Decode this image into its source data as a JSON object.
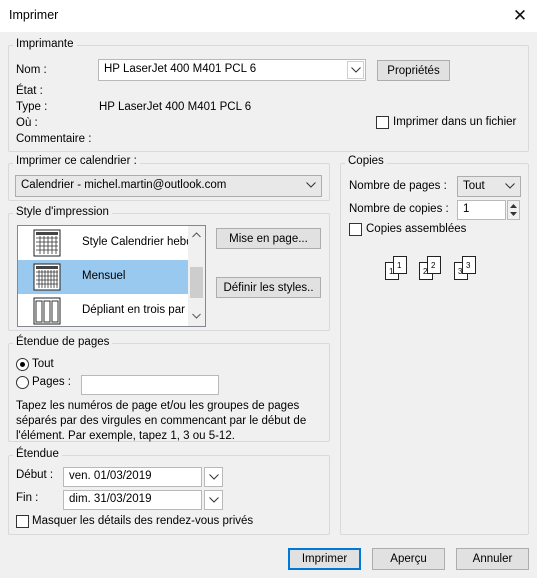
{
  "window": {
    "title": "Imprimer",
    "close_glyph": "✕"
  },
  "printer": {
    "legend": "Imprimante",
    "name_label": "Nom :",
    "name_value": "HP LaserJet 400 M401 PCL 6",
    "properties_button": "Propriétés",
    "status_label": "État :",
    "type_label": "Type :",
    "type_value": "HP LaserJet 400 M401 PCL 6",
    "where_label": "Où :",
    "comment_label": "Commentaire :",
    "print_to_file_label": "Imprimer dans un fichier",
    "print_to_file_checked": false
  },
  "calendar": {
    "legend": "Imprimer ce calendrier :",
    "selected": "Calendrier - michel.martin@outlook.com"
  },
  "print_style": {
    "legend": "Style d'impression",
    "items": [
      {
        "label": "Style Calendrier hebd",
        "icon": "weekly-calendar-icon"
      },
      {
        "label": "Mensuel",
        "icon": "monthly-calendar-icon"
      },
      {
        "label": "Dépliant en trois par",
        "icon": "trifold-icon"
      }
    ],
    "selected_index": 1,
    "page_setup_button": "Mise en page...",
    "define_styles_button": "Définir les styles.."
  },
  "page_range": {
    "legend": "Étendue de pages",
    "all_label": "Tout",
    "pages_label": "Pages :",
    "pages_value": "",
    "help_lines": [
      "Tapez les numéros de page et/ou les groupes de pages",
      "séparés par des virgules en commencant par le début de",
      "l'élément. Par exemple, tapez 1, 3 ou 5-12."
    ]
  },
  "range": {
    "legend": "Étendue",
    "start_label": "Début :",
    "start_value": "ven. 01/03/2019",
    "end_label": "Fin :",
    "end_value": "dim. 31/03/2019",
    "hide_details_label": "Masquer les détails des rendez-vous privés",
    "hide_details_checked": false
  },
  "copies": {
    "legend": "Copies",
    "pages_count_label": "Nombre de pages :",
    "pages_count_value": "Tout",
    "copies_count_label": "Nombre de copies :",
    "copies_count_value": "1",
    "collate_label": "Copies assemblées",
    "collate_checked": false,
    "collate_preview_pages": [
      "1",
      "1",
      "2",
      "2",
      "3",
      "3"
    ]
  },
  "footer": {
    "print_button": "Imprimer",
    "preview_button": "Aperçu",
    "cancel_button": "Annuler"
  },
  "colors": {
    "selection": "#99c9ef",
    "default_button_border": "#0078d7",
    "background": "#f0f0f0"
  }
}
